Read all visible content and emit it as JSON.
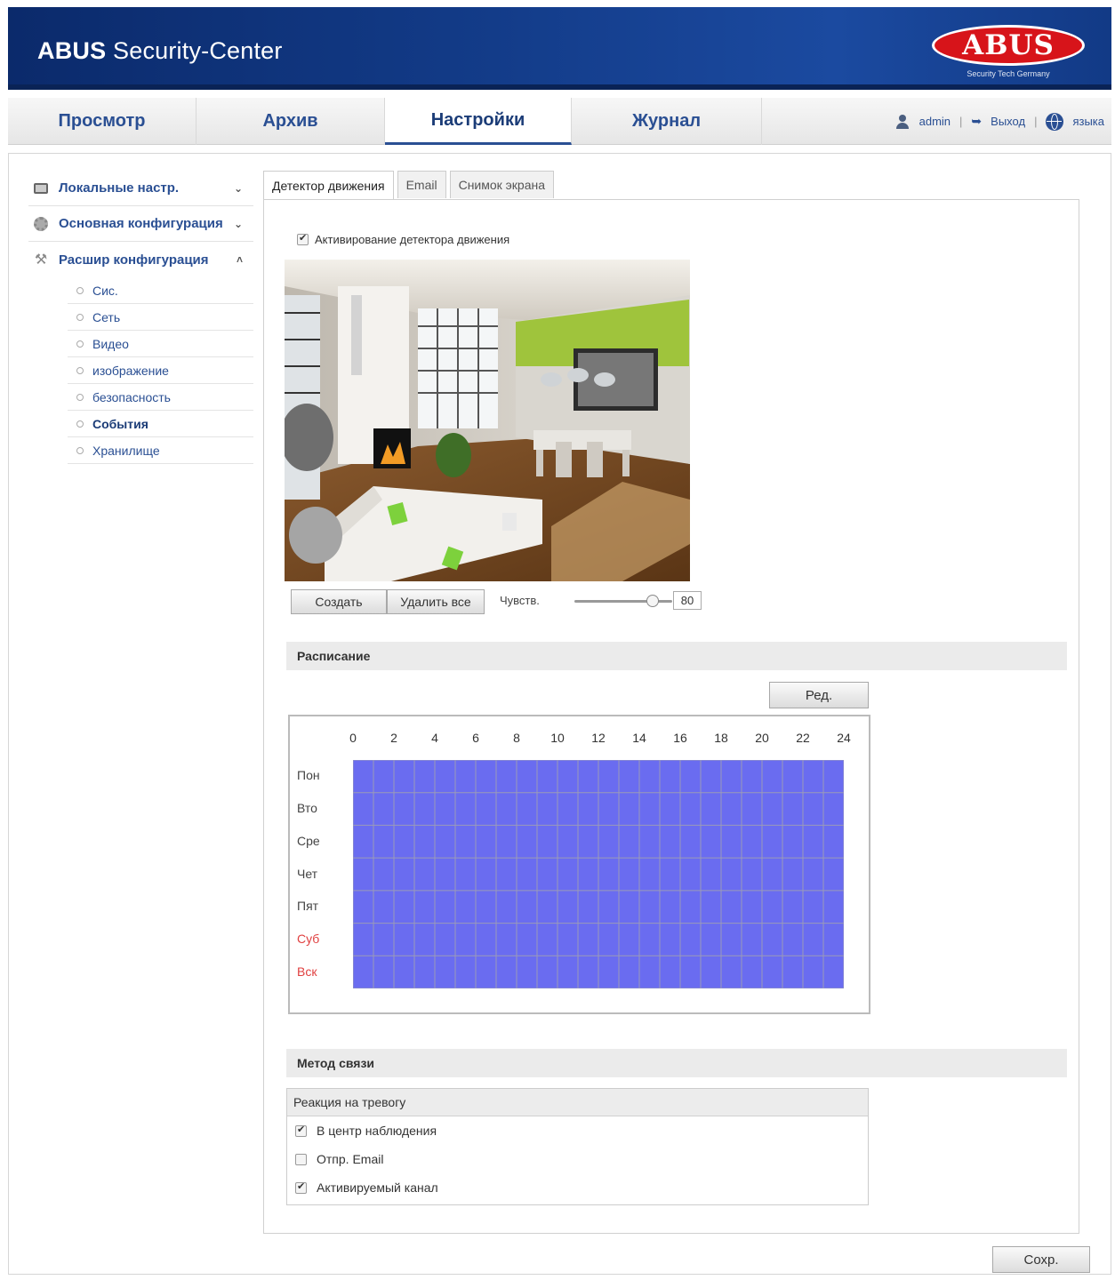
{
  "header": {
    "title_bold": "ABUS",
    "title_rest": " Security-Center",
    "logo_text": "ABUS",
    "logo_tagline": "Security Tech Germany"
  },
  "nav": {
    "tabs": [
      {
        "label": "Просмотр",
        "active": false
      },
      {
        "label": "Архив",
        "active": false
      },
      {
        "label": "Настройки",
        "active": true
      },
      {
        "label": "Журнал",
        "active": false
      }
    ],
    "user": "admin",
    "logout": "Выход",
    "language": "языка"
  },
  "sidebar": {
    "local": "Локальные настр.",
    "basic": "Основная конфигурация",
    "advanced": "Расшир конфигурация",
    "items": [
      {
        "label": "Сис.",
        "active": false
      },
      {
        "label": "Сеть",
        "active": false
      },
      {
        "label": "Видео",
        "active": false
      },
      {
        "label": "изображение",
        "active": false
      },
      {
        "label": "безопасность",
        "active": false
      },
      {
        "label": "События",
        "active": true
      },
      {
        "label": "Хранилище",
        "active": false
      }
    ]
  },
  "tabs": [
    {
      "label": "Детектор движения",
      "active": true
    },
    {
      "label": "Email",
      "active": false
    },
    {
      "label": "Снимок экрана",
      "active": false
    }
  ],
  "motion": {
    "activate_label": "Активирование детектора движения",
    "activate_checked": true,
    "create_button": "Создать",
    "delete_all_button": "Удалить все",
    "sensitivity_label": "Чувств.",
    "sensitivity_value": "80",
    "sensitivity_fraction": 0.8
  },
  "schedule": {
    "title": "Расписание",
    "edit_button": "Ред.",
    "hours": [
      "0",
      "2",
      "4",
      "6",
      "8",
      "10",
      "12",
      "14",
      "16",
      "18",
      "20",
      "22",
      "24"
    ],
    "days": [
      {
        "label": "Пон",
        "weekend": false
      },
      {
        "label": "Вто",
        "weekend": false
      },
      {
        "label": "Сре",
        "weekend": false
      },
      {
        "label": "Чет",
        "weekend": false
      },
      {
        "label": "Пят",
        "weekend": false
      },
      {
        "label": "Суб",
        "weekend": true
      },
      {
        "label": "Вск",
        "weekend": true
      }
    ],
    "fill_color": "#6a6cf0"
  },
  "linkage": {
    "title": "Метод связи",
    "alarm_header": "Реакция на тревогу",
    "options": [
      {
        "label": "В центр наблюдения",
        "checked": true
      },
      {
        "label": "Отпр. Email",
        "checked": false
      },
      {
        "label": "Активируемый канал",
        "checked": true
      }
    ]
  },
  "save_button": "Сохр.",
  "colors": {
    "brand_blue": "#2a4f93",
    "logo_red": "#d7141a",
    "weekend_red": "#e04040"
  }
}
